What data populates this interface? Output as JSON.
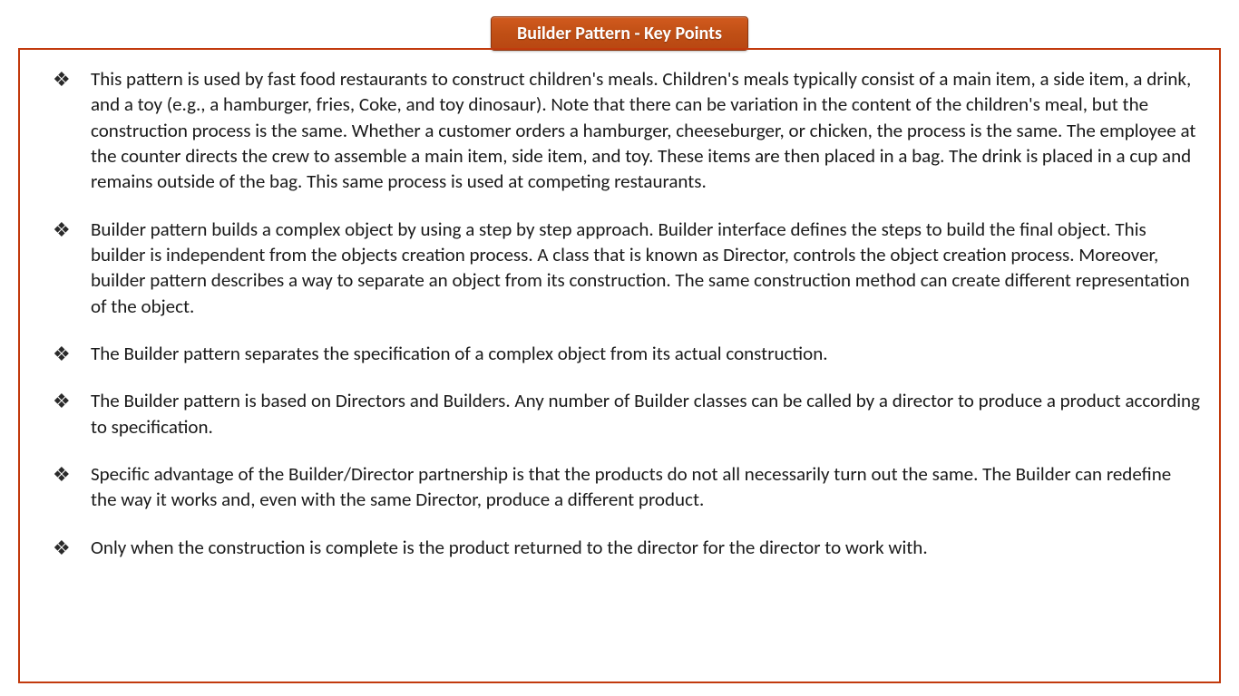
{
  "title": "Builder Pattern - Key Points",
  "points": [
    "This pattern is used by fast food restaurants to construct children's meals. Children's meals typically consist of a main item, a side item, a drink, and a toy (e.g., a hamburger, fries, Coke, and toy dinosaur). Note that there can be variation in the content of the children's meal, but the construction process is the same. Whether a customer orders a hamburger, cheeseburger, or chicken, the process is the same. The employee at the counter directs the crew to assemble a main item, side item, and toy. These items are then placed in a bag. The drink is placed in a cup and remains outside of the bag. This same process is used at competing restaurants.",
    "Builder pattern builds a complex object by using a step by step approach. Builder interface defines the steps to build the final object. This builder is independent from the objects creation process. A class that is known as Director, controls the object creation process. Moreover, builder pattern describes a way to separate an object from its construction. The same construction method can create different representation of the object.",
    "The Builder pattern separates the specification of a complex object from its actual construction.",
    "The Builder pattern is based on Directors and Builders. Any number of Builder classes can be called by a director to produce a product according to specification.",
    "Specific advantage of the Builder/Director partnership is that the products do not all necessarily turn out the same. The Builder can redefine the way it works and, even with the same Director, produce a different product.",
    "Only when the construction is complete is the product returned to the director for the director to work with."
  ]
}
